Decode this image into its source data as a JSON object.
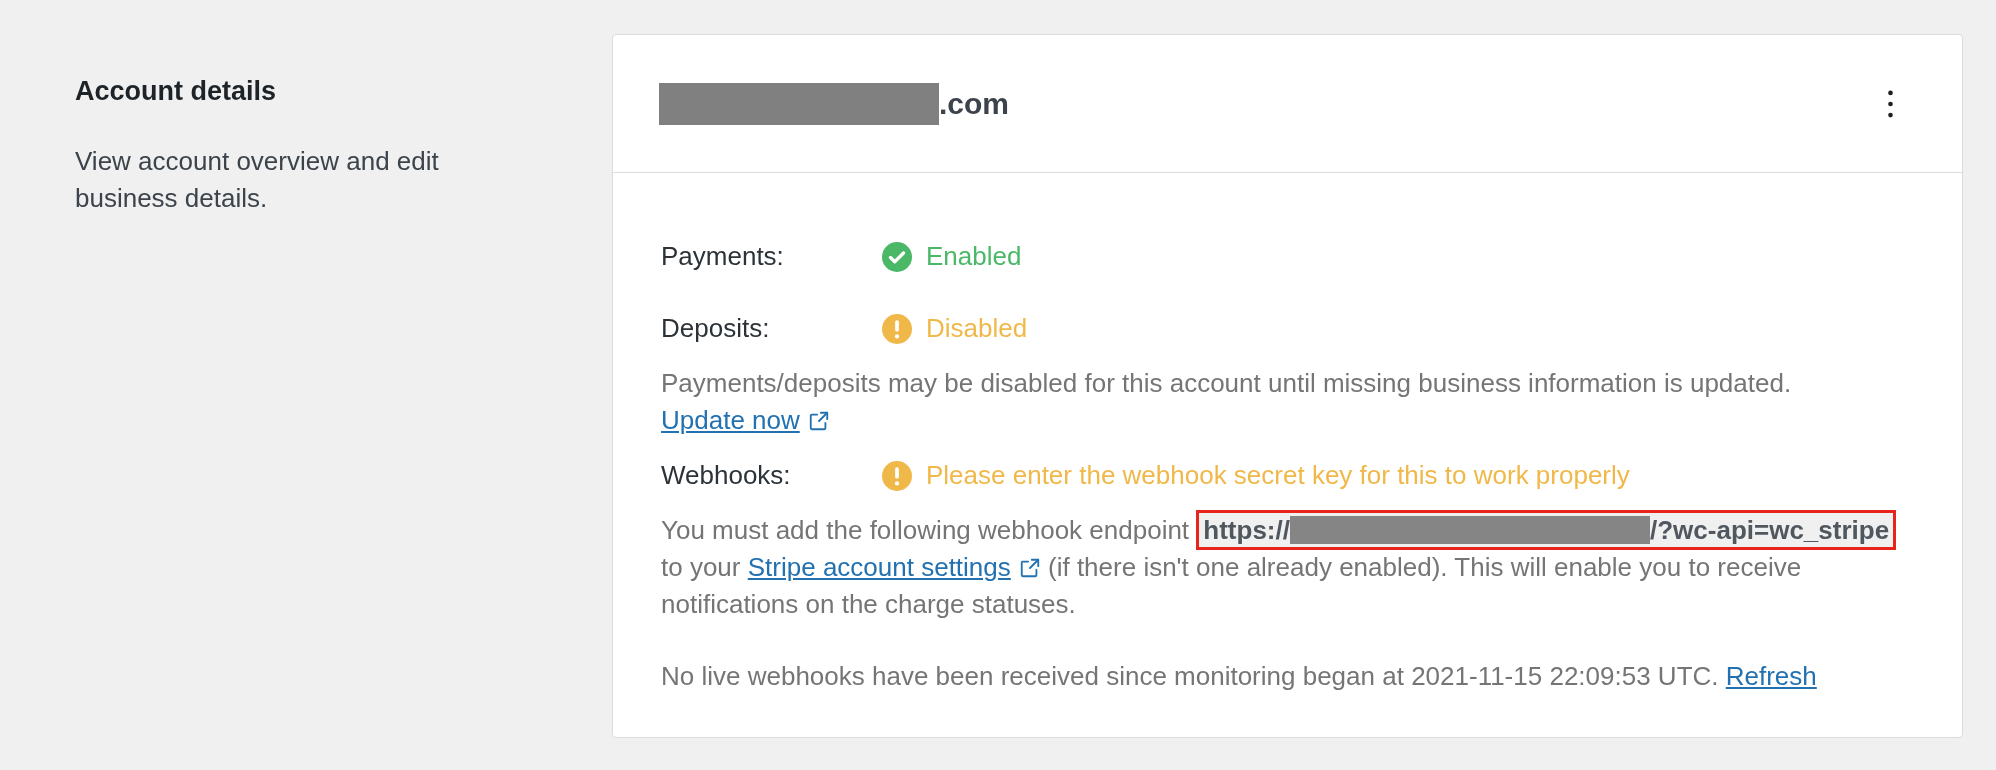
{
  "section": {
    "title": "Account details",
    "description": "View account overview and edit business details."
  },
  "account": {
    "name_redacted": true,
    "name_suffix": ".com"
  },
  "statuses": [
    {
      "label": "Payments:",
      "kind": "success",
      "value": "Enabled"
    },
    {
      "label": "Deposits:",
      "kind": "warning",
      "value": "Disabled"
    }
  ],
  "deposits_note": {
    "text": "Payments/deposits may be disabled for this account until missing business information is updated.",
    "link": "Update now"
  },
  "webhooks": {
    "label": "Webhooks:",
    "kind": "warning",
    "value": "Please enter the webhook secret key for this to work properly",
    "text_before": "You must add the following webhook endpoint",
    "endpoint": {
      "prefix": "https://",
      "redacted": true,
      "suffix": "/?wc-api=wc_stripe",
      "highlighted": true
    },
    "text_middle": "to your",
    "link": "Stripe account settings",
    "text_after": "(if there isn't one already enabled). This will enable you to receive notifications on the charge statuses."
  },
  "monitoring": {
    "text": "No live webhooks have been received since monitoring began at 2021-11-15 22:09:53 UTC.",
    "link": "Refresh"
  }
}
